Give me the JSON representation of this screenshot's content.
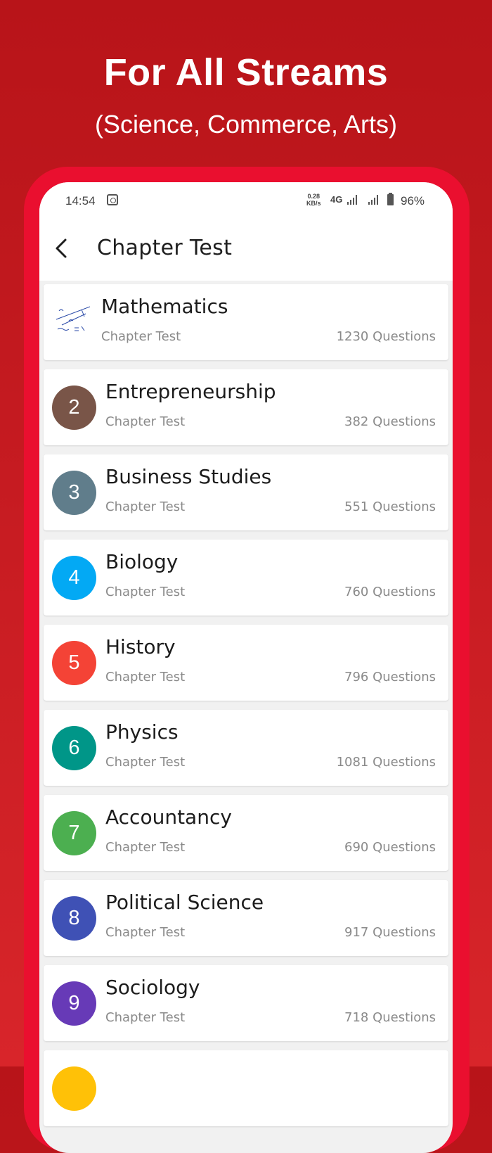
{
  "promo": {
    "title": "For All Streams",
    "subtitle": "(Science, Commerce, Arts)"
  },
  "status_bar": {
    "time": "14:54",
    "speed_value": "0.28",
    "speed_unit": "KB/s",
    "network": "4G",
    "battery": "96%"
  },
  "app_bar": {
    "title": "Chapter Test",
    "back_icon": "arrow-back-icon"
  },
  "subjects": [
    {
      "number": "",
      "name": "Mathematics",
      "subtitle": "Chapter Test",
      "count": "1230 Questions",
      "color": "#ffffff",
      "icon": "math-notes-thumbnail"
    },
    {
      "number": "2",
      "name": "Entrepreneurship",
      "subtitle": "Chapter Test",
      "count": "382 Questions",
      "color": "#795548"
    },
    {
      "number": "3",
      "name": "Business Studies",
      "subtitle": "Chapter Test",
      "count": "551 Questions",
      "color": "#607d8b"
    },
    {
      "number": "4",
      "name": "Biology",
      "subtitle": "Chapter Test",
      "count": "760 Questions",
      "color": "#03a9f4"
    },
    {
      "number": "5",
      "name": "History",
      "subtitle": "Chapter Test",
      "count": "796 Questions",
      "color": "#f44336"
    },
    {
      "number": "6",
      "name": "Physics",
      "subtitle": "Chapter Test",
      "count": "1081 Questions",
      "color": "#009688"
    },
    {
      "number": "7",
      "name": "Accountancy",
      "subtitle": "Chapter Test",
      "count": "690 Questions",
      "color": "#4caf50"
    },
    {
      "number": "8",
      "name": "Political Science",
      "subtitle": "Chapter Test",
      "count": "917 Questions",
      "color": "#3f51b5"
    },
    {
      "number": "9",
      "name": "Sociology",
      "subtitle": "Chapter Test",
      "count": "718 Questions",
      "color": "#673ab7"
    }
  ],
  "colors": {
    "background": "#c11a20",
    "frame": "#ea0f2f"
  }
}
